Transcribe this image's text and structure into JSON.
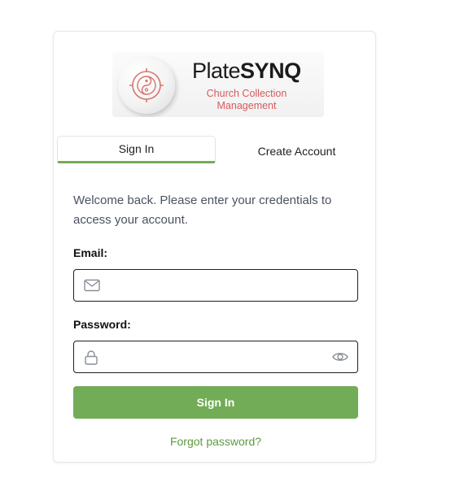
{
  "brand": {
    "name_light": "Plate",
    "name_bold": "SYNQ",
    "subtitle_line1": "Church Collection",
    "subtitle_line2": "Management",
    "emblem_icon": "yin-yang-target-icon",
    "accent_color": "#d55b5b"
  },
  "tabs": [
    {
      "label": "Sign In",
      "active": true
    },
    {
      "label": "Create Account",
      "active": false
    }
  ],
  "form": {
    "welcome": "Welcome back. Please enter your credentials to access your account.",
    "email": {
      "label": "Email:",
      "value": "",
      "placeholder": "",
      "icon": "mail-icon"
    },
    "password": {
      "label": "Password:",
      "value": "",
      "placeholder": "",
      "icon": "lock-icon",
      "toggle_icon": "eye-icon"
    },
    "submit_label": "Sign In",
    "forgot_label": "Forgot password?"
  },
  "colors": {
    "primary": "#72ac57",
    "link": "#5d9a41"
  }
}
